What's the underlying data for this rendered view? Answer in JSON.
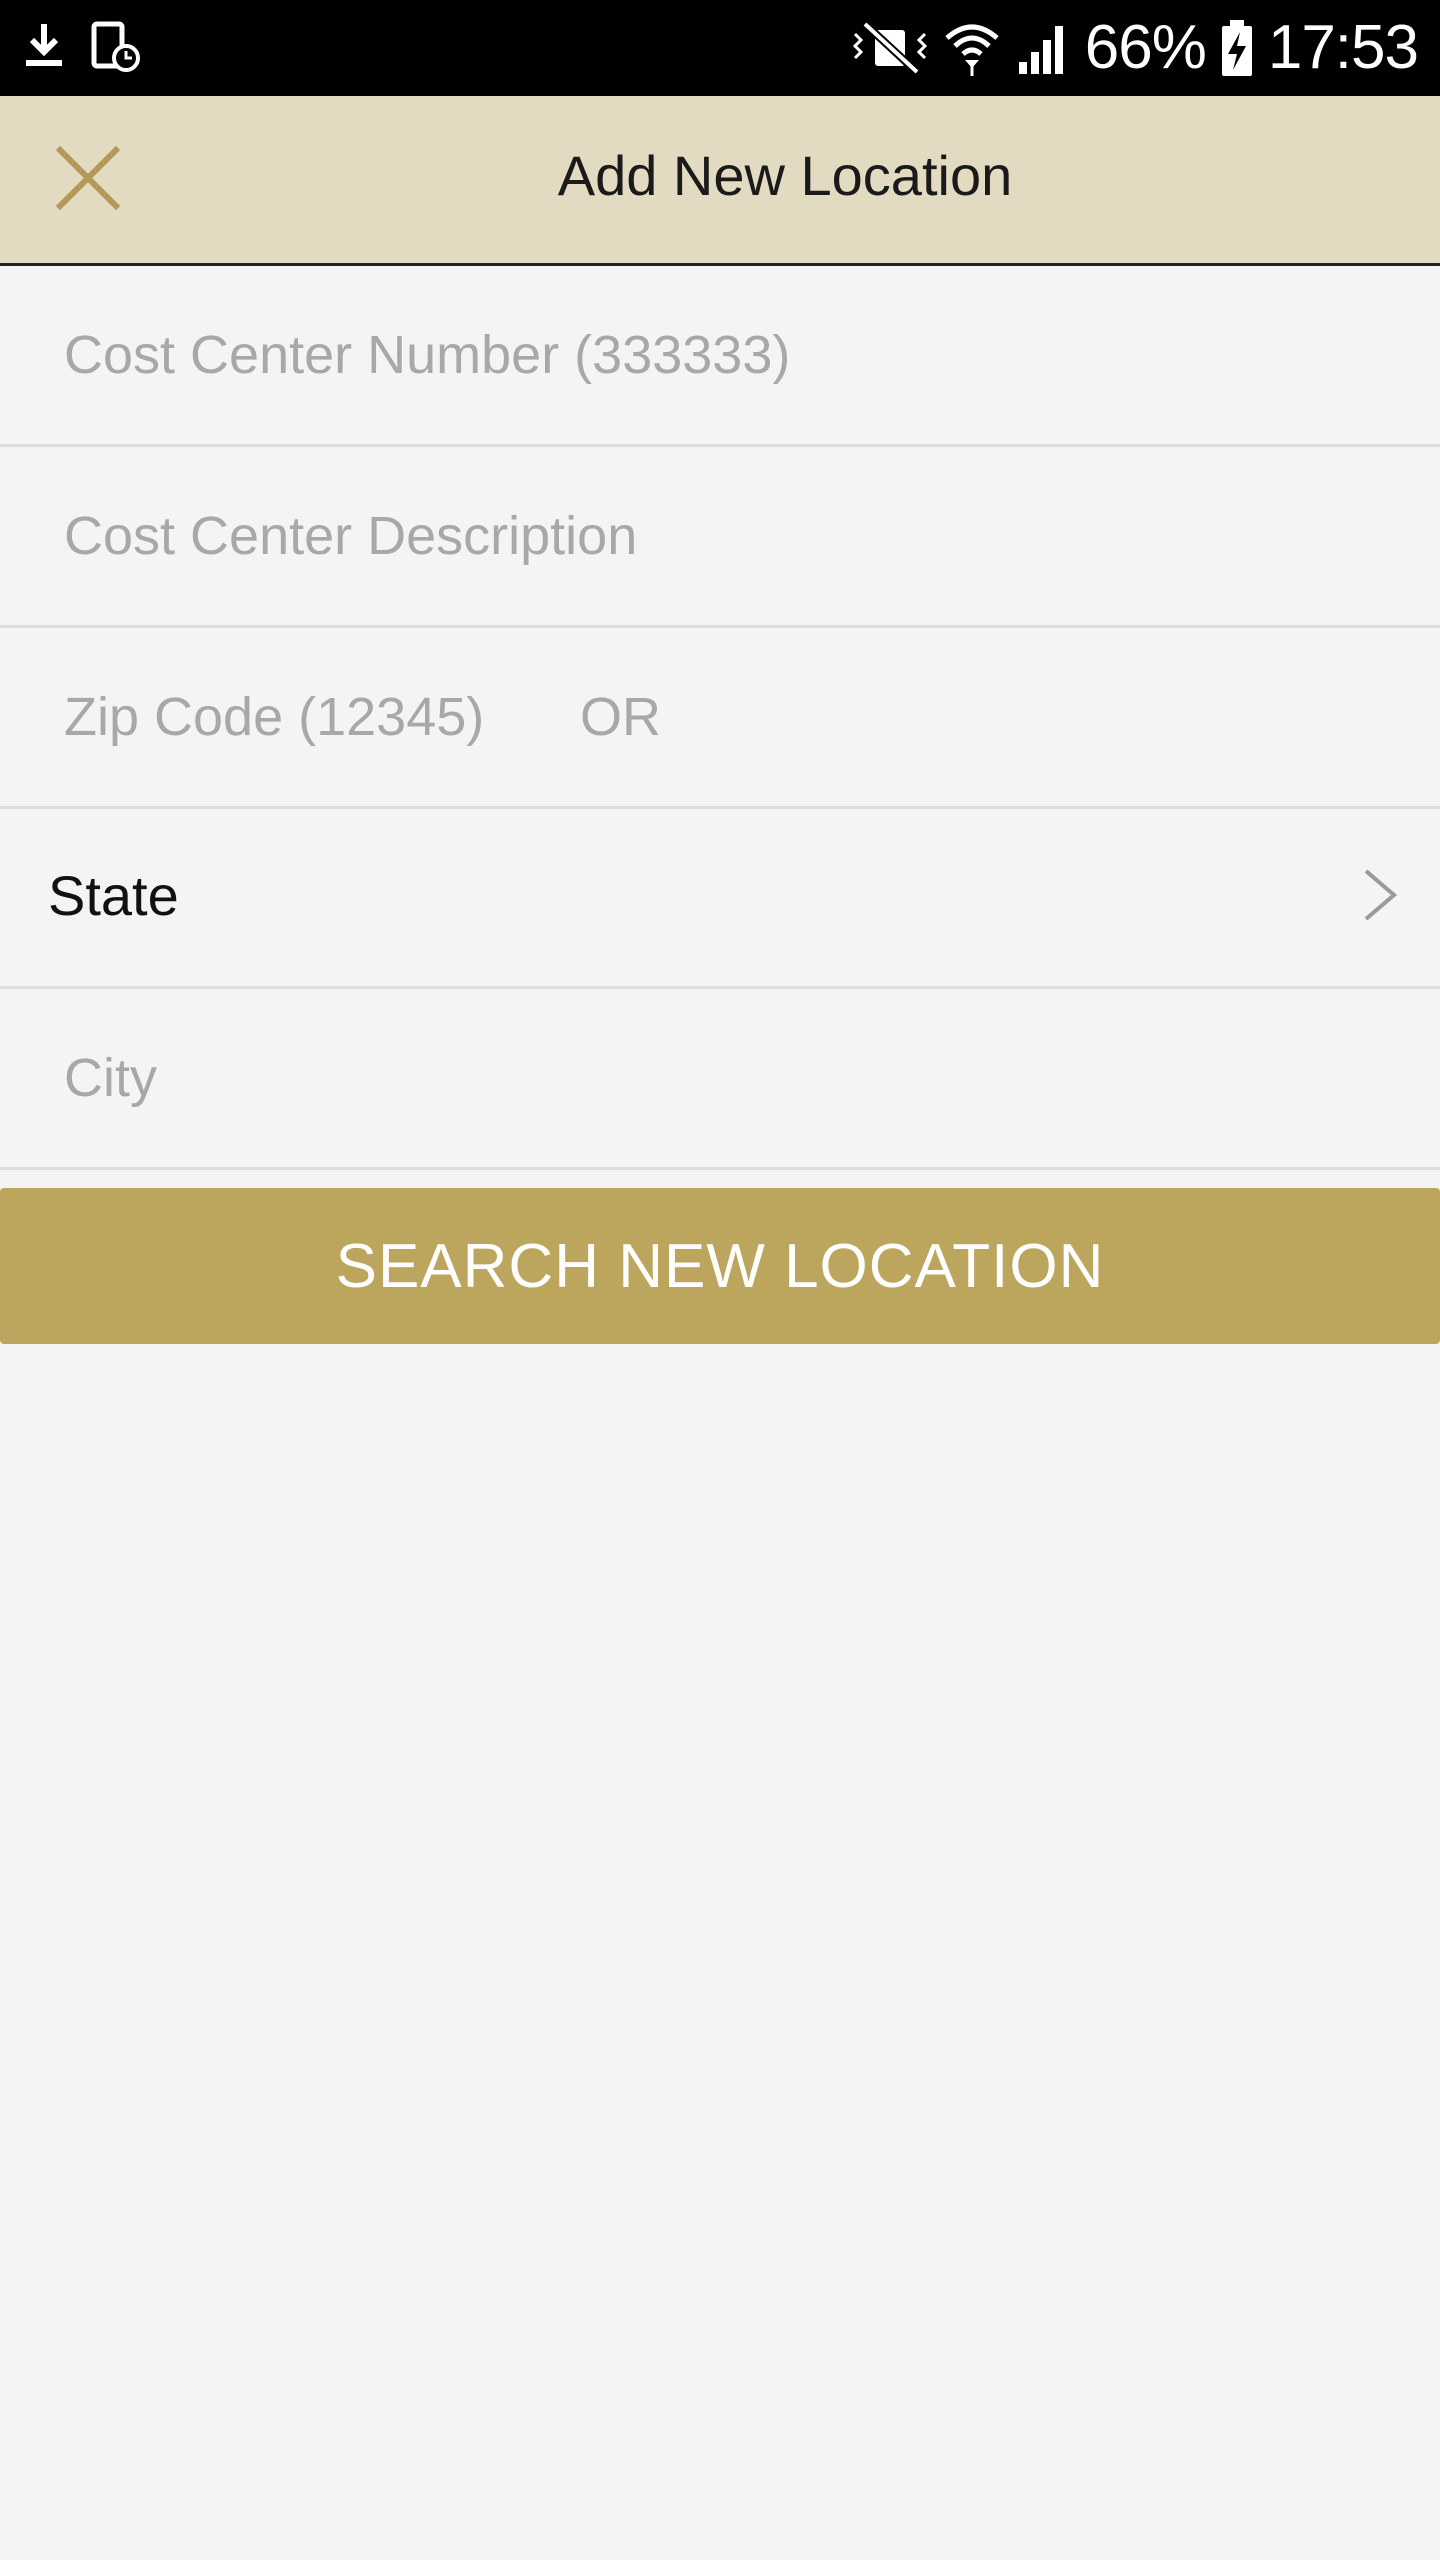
{
  "status_bar": {
    "battery": "66%",
    "time": "17:53",
    "icons": [
      "download-icon",
      "device-clock-icon",
      "vibrate-mute-icon",
      "wifi-icon",
      "signal-icon",
      "battery-charging-icon"
    ]
  },
  "header": {
    "title": "Add New Location",
    "close_icon": "close-icon"
  },
  "form": {
    "cost_center_number": {
      "value": "",
      "placeholder": "Cost Center Number (333333)"
    },
    "cost_center_description": {
      "value": "",
      "placeholder": "Cost Center Description"
    },
    "zip_code": {
      "value": "",
      "placeholder": "Zip Code (12345)"
    },
    "or_label": "OR",
    "state": {
      "label": "State",
      "icon": "chevron-right-icon"
    },
    "city": {
      "value": "",
      "placeholder": "City"
    }
  },
  "actions": {
    "search_label": "SEARCH NEW LOCATION"
  },
  "colors": {
    "header_bg": "#e2dbc2",
    "accent": "#bca55c",
    "close_icon": "#b39a58",
    "background": "#f4f4f4"
  }
}
